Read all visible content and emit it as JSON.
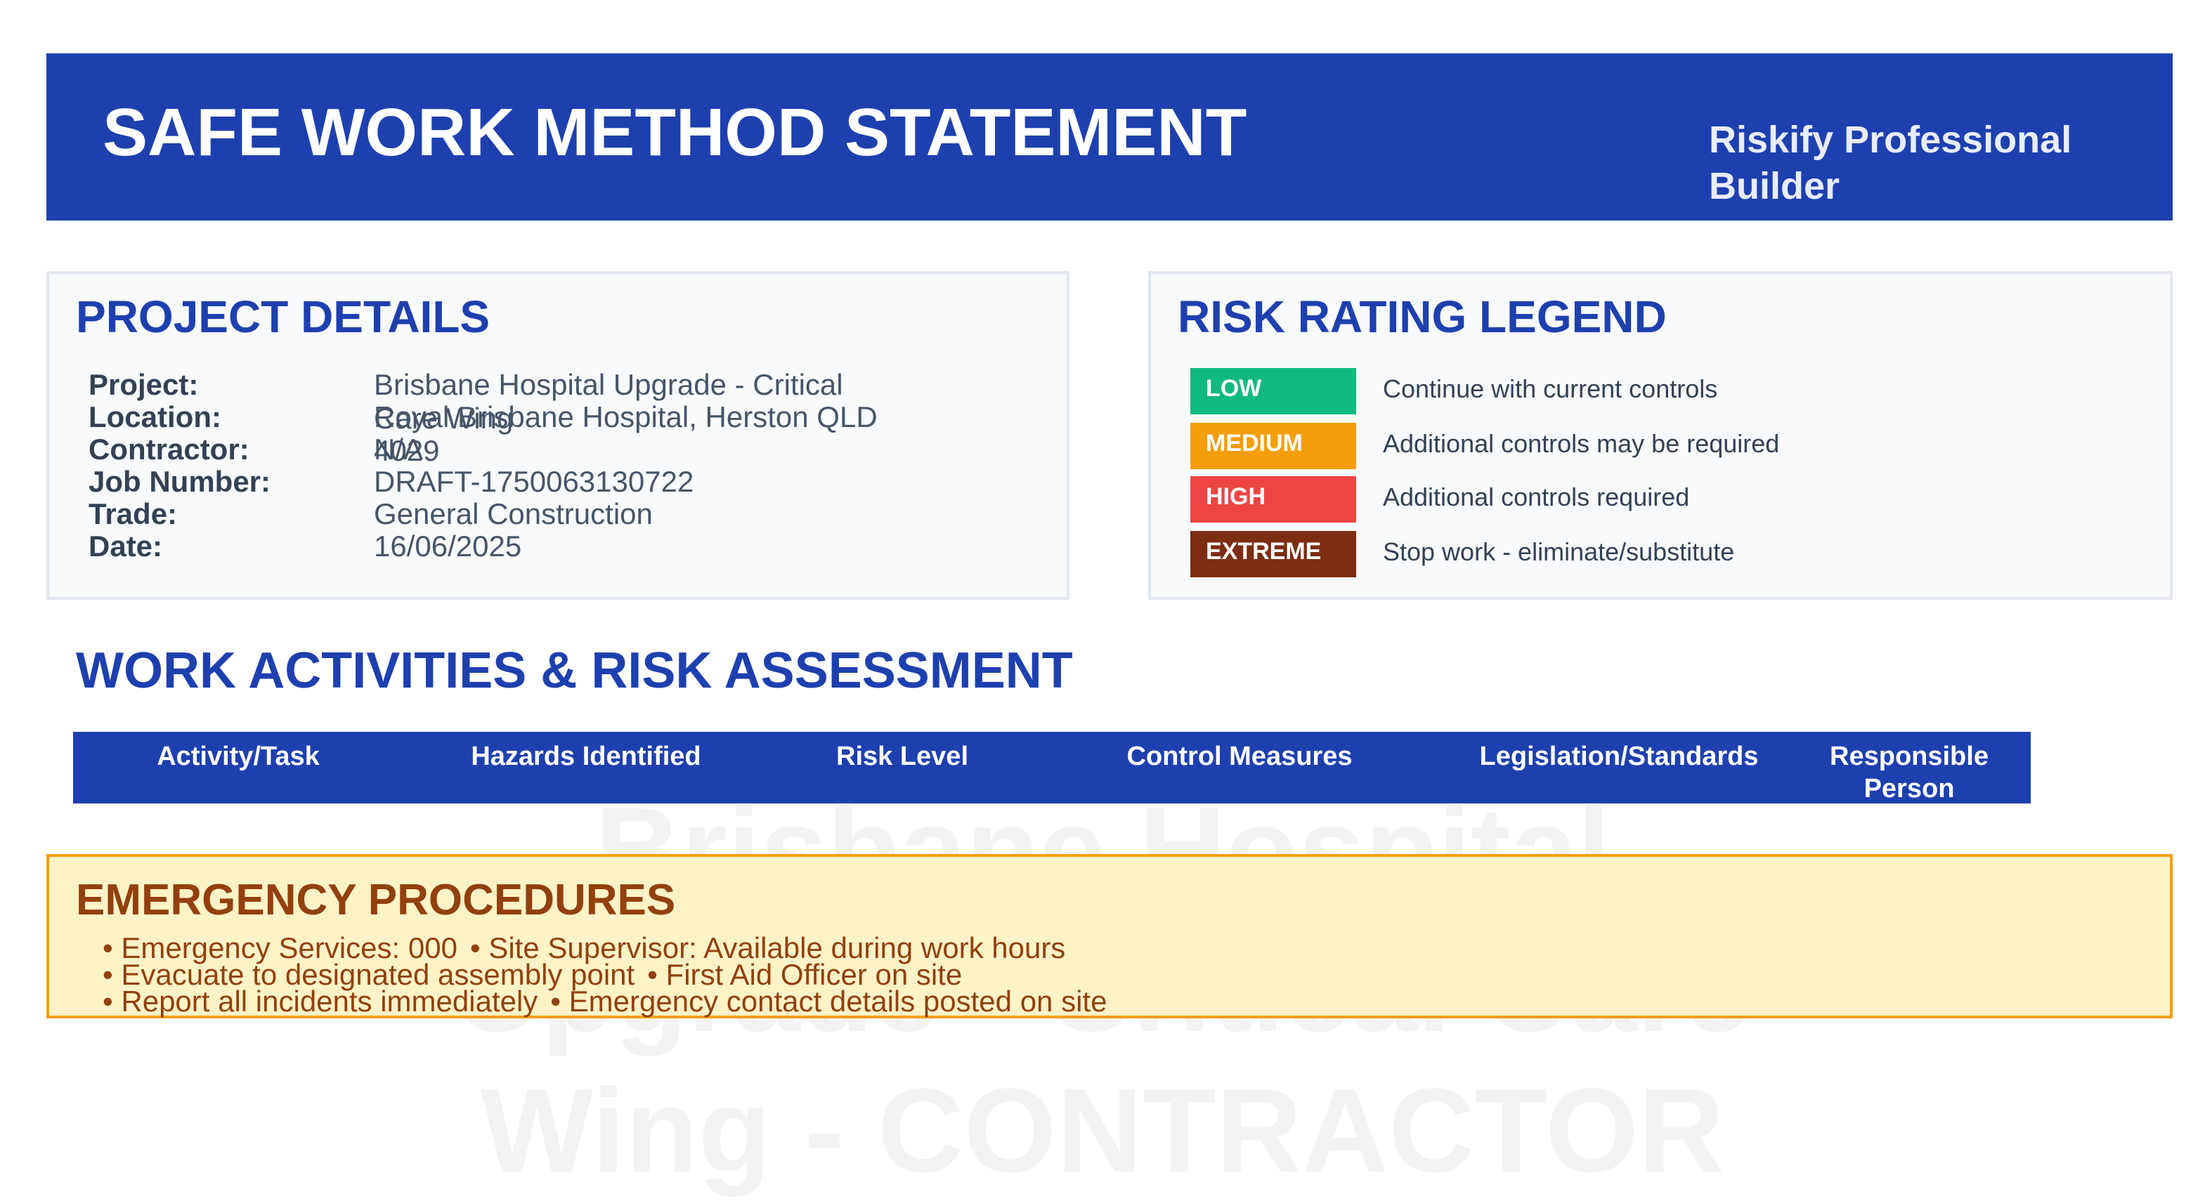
{
  "watermark": {
    "line1": "Brisbane Hospital",
    "line2": "Upgrade - Critical Care",
    "line3": "Wing - CONTRACTOR"
  },
  "header": {
    "title": "SAFE WORK METHOD STATEMENT",
    "brand": "Riskify Professional Builder",
    "background_color": "#1e40af"
  },
  "project_details": {
    "heading": "PROJECT DETAILS",
    "rows": [
      {
        "label": "Project:",
        "value": "Brisbane Hospital Upgrade - Critical Care Wing"
      },
      {
        "label": "Location:",
        "value": "Royal Brisbane Hospital, Herston QLD 4029"
      },
      {
        "label": "Contractor:",
        "value": "N/A"
      },
      {
        "label": "Job Number:",
        "value": "DRAFT-1750063130722"
      },
      {
        "label": "Trade:",
        "value": "General Construction"
      },
      {
        "label": "Date:",
        "value": "16/06/2025"
      }
    ]
  },
  "risk_legend": {
    "heading": "RISK RATING LEGEND",
    "levels": [
      {
        "label": "LOW",
        "description": "Continue with current controls",
        "color": "#10b981"
      },
      {
        "label": "MEDIUM",
        "description": "Additional controls may be required",
        "color": "#f59e0b"
      },
      {
        "label": "HIGH",
        "description": "Additional controls required",
        "color": "#ef4444"
      },
      {
        "label": "EXTREME",
        "description": "Stop work - eliminate/substitute",
        "color": "#7c2d12"
      }
    ]
  },
  "activities": {
    "heading": "WORK ACTIVITIES & RISK ASSESSMENT",
    "columns": [
      "Activity/Task",
      "Hazards Identified",
      "Risk Level",
      "Control Measures",
      "Legislation/Standards",
      "Responsible Person"
    ]
  },
  "emergency": {
    "heading": "EMERGENCY PROCEDURES",
    "lines": [
      [
        "Emergency Services: 000",
        "Site Supervisor: Available during work hours"
      ],
      [
        "Evacuate to designated assembly point",
        "First Aid Officer on site"
      ],
      [
        "Report all incidents immediately",
        "Emergency contact details posted on site"
      ]
    ],
    "background_color": "#fef3c7",
    "border_color": "#f59e0b"
  }
}
